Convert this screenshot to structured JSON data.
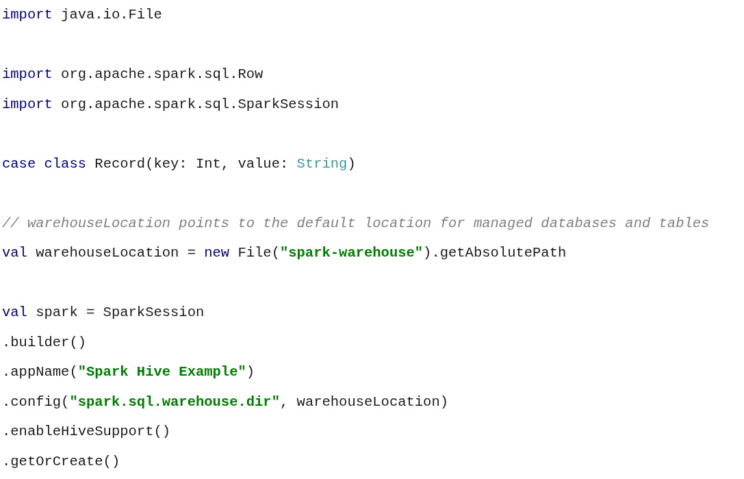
{
  "code_block": {
    "lines": [
      {
        "kind": "code",
        "tokens": [
          {
            "kind": "keyword",
            "text": "import"
          },
          {
            "kind": "plain",
            "text": " java.io.File"
          }
        ]
      },
      {
        "kind": "blank"
      },
      {
        "kind": "code",
        "tokens": [
          {
            "kind": "keyword",
            "text": "import"
          },
          {
            "kind": "plain",
            "text": " org.apache.spark.sql.Row"
          }
        ]
      },
      {
        "kind": "code",
        "tokens": [
          {
            "kind": "keyword",
            "text": "import"
          },
          {
            "kind": "plain",
            "text": " org.apache.spark.sql.SparkSession"
          }
        ]
      },
      {
        "kind": "blank"
      },
      {
        "kind": "code",
        "tokens": [
          {
            "kind": "keyword",
            "text": "case class"
          },
          {
            "kind": "plain",
            "text": " Record(key: Int, value: "
          },
          {
            "kind": "type",
            "text": "String"
          },
          {
            "kind": "plain",
            "text": ")"
          }
        ]
      },
      {
        "kind": "blank"
      },
      {
        "kind": "code",
        "tokens": [
          {
            "kind": "comment",
            "text": "// warehouseLocation points to the default location for managed databases and tables"
          }
        ]
      },
      {
        "kind": "code",
        "tokens": [
          {
            "kind": "keyword",
            "text": "val"
          },
          {
            "kind": "plain",
            "text": " warehouseLocation = "
          },
          {
            "kind": "keyword",
            "text": "new"
          },
          {
            "kind": "plain",
            "text": " File("
          },
          {
            "kind": "string",
            "text": "\"spark-warehouse\""
          },
          {
            "kind": "plain",
            "text": ").getAbsolutePath"
          }
        ]
      },
      {
        "kind": "blank"
      },
      {
        "kind": "code",
        "tokens": [
          {
            "kind": "keyword",
            "text": "val"
          },
          {
            "kind": "plain",
            "text": " spark = SparkSession"
          }
        ]
      },
      {
        "kind": "code",
        "tokens": [
          {
            "kind": "plain",
            "text": ".builder()"
          }
        ]
      },
      {
        "kind": "code",
        "tokens": [
          {
            "kind": "plain",
            "text": ".appName("
          },
          {
            "kind": "string",
            "text": "\"Spark Hive Example\""
          },
          {
            "kind": "plain",
            "text": ")"
          }
        ]
      },
      {
        "kind": "code",
        "tokens": [
          {
            "kind": "plain",
            "text": ".config("
          },
          {
            "kind": "string",
            "text": "\"spark.sql.warehouse.dir\""
          },
          {
            "kind": "plain",
            "text": ", warehouseLocation)"
          }
        ]
      },
      {
        "kind": "code",
        "tokens": [
          {
            "kind": "plain",
            "text": ".enableHiveSupport()"
          }
        ]
      },
      {
        "kind": "code",
        "tokens": [
          {
            "kind": "plain",
            "text": ".getOrCreate()"
          }
        ]
      }
    ]
  }
}
